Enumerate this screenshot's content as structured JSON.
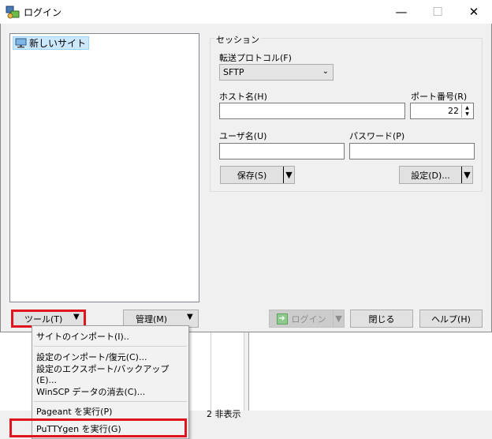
{
  "window": {
    "title": "ログイン"
  },
  "site_list": {
    "items": [
      {
        "label": "新しいサイト"
      }
    ]
  },
  "session": {
    "group_label": "セッション",
    "protocol_label": "転送プロトコル(F)",
    "protocol_value": "SFTP",
    "host_label": "ホスト名(H)",
    "host_value": "",
    "port_label": "ポート番号(R)",
    "port_value": "22",
    "user_label": "ユーザ名(U)",
    "user_value": "",
    "password_label": "パスワード(P)",
    "password_value": "",
    "save_label": "保存(S)",
    "settings_label": "設定(D)..."
  },
  "buttons": {
    "tools": "ツール(T)",
    "manage": "管理(M)",
    "login": "ログイン",
    "close": "閉じる",
    "help": "ヘルプ(H)"
  },
  "tools_menu": {
    "items": [
      "サイトのインポート(I)..",
      "設定のインポート/復元(C)...",
      "設定のエクスポート/バックアップ(E)...",
      "WinSCP データの消去(C)...",
      "Pageant を実行(P)",
      "PuTTYgen を実行(G)"
    ]
  },
  "background_window": {
    "status_text": "2 非表示"
  },
  "colors": {
    "highlight": "#e0141e",
    "selection": "#cce8ff"
  }
}
